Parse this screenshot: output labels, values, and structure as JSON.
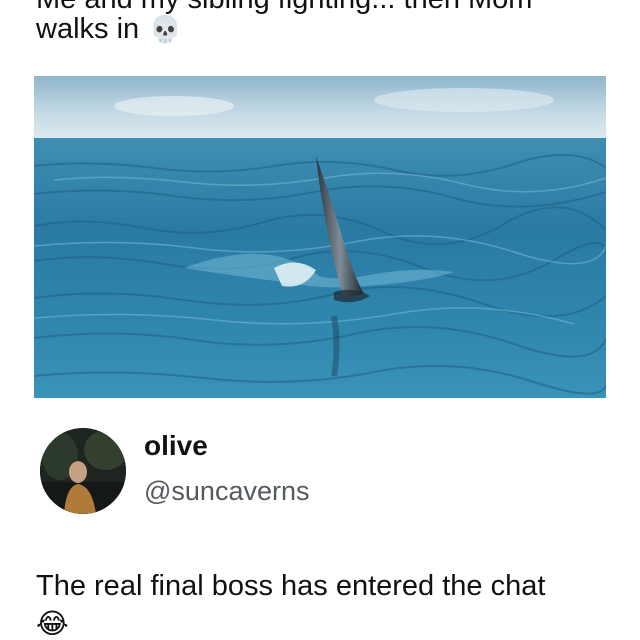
{
  "caption": {
    "line1": "Me and my sibling fighting... then Mom",
    "line2": "walks in",
    "emoji": "💀"
  },
  "media": {
    "icon": "shark-fin-ocean-image"
  },
  "tweet": {
    "display_name": "olive",
    "handle": "@suncaverns",
    "text": "The real final boss has entered the chat",
    "emoji": "😂"
  }
}
